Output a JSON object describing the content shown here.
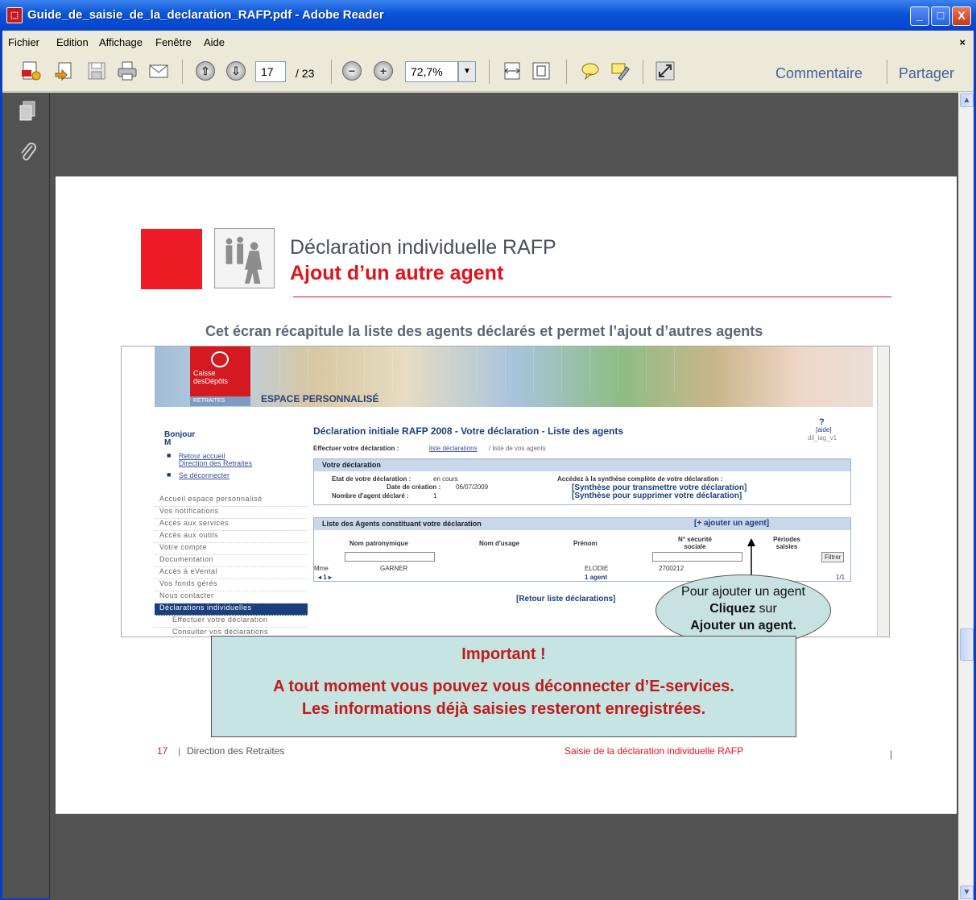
{
  "window": {
    "title": "Guide_de_saisie_de_la_declaration_RAFP.pdf - Adobe Reader",
    "buttons": {
      "minimize": "_",
      "maximize": "□",
      "close": "X"
    }
  },
  "menu": {
    "items": [
      "Fichier",
      "Edition",
      "Affichage",
      "Fenêtre",
      "Aide"
    ],
    "close_doc": "×"
  },
  "toolbar": {
    "page_current": "17",
    "page_total": "/ 23",
    "zoom": "72,7%",
    "commentaire": "Commentaire",
    "partager": "Partager"
  },
  "page": {
    "heading1": "Déclaration individuelle RAFP",
    "heading2": "Ajout d’un autre agent",
    "caption": "Cet écran récapitule la liste des agents déclarés et permet l’ajout d’autres agents",
    "screenshot": {
      "logo_line1": "Caisse",
      "logo_line2": "desDépôts",
      "logo_sub": "RETRAITES",
      "espace": "ESPACE PERSONNALISÉ",
      "bonjour": "Bonjour",
      "user_initial": "M",
      "links": [
        "Retour accueil",
        "Direction des Retraites",
        "Se déconnecter"
      ],
      "nav": [
        "Accueil espace personnalisé",
        "Vos notifications",
        "Accès aux services",
        "Accès aux outils",
        "Votre compte",
        "Documentation",
        "Accès à eVental",
        "Vos fonds gérés",
        "Nous contacter",
        "Déclarations individuelles",
        "Effectuer votre déclaration",
        "Consulter vos déclarations"
      ],
      "main_title": "Déclaration initiale RAFP 2008 - Votre déclaration - Liste des agents",
      "aide": "[aide]",
      "code": "dil_iag_v1",
      "breadcrumb_label": "Effectuer votre déclaration :",
      "breadcrumb_link": "liste déclarations",
      "breadcrumb_rest": "/ liste de vos agents",
      "box1_title": "Votre déclaration",
      "etat_label": "Etat de votre déclaration :",
      "etat_value": "en cours",
      "date_label": "Date de création :",
      "date_value": "06/07/2009",
      "nb_label": "Nombre d'agent déclaré :",
      "nb_value": "1",
      "synth_intro": "Accédez à la synthèse complète de votre déclaration :",
      "synth_transmettre": "[Synthèse pour transmettre votre déclaration]",
      "synth_supprimer": "[Synthèse pour supprimer votre déclaration]",
      "box2_title": "Liste des Agents constituant votre déclaration",
      "add_agent": "[+ ajouter un agent]",
      "columns": [
        "Nom patronymique",
        "Nom d'usage",
        "Prénom",
        "N° sécurité sociale",
        "Périodes saisies"
      ],
      "filter": "Filtrer",
      "row": {
        "civ": "Mme",
        "nom": "GARNER",
        "prenom": "ELODIE",
        "nss": "2700212"
      },
      "count": "1 agent",
      "pager": "1/1",
      "retour": "[Retour liste déclarations]"
    },
    "callout_line1": "Pour ajouter un agent",
    "callout_bold": "Cliquez",
    "callout_sur": "sur",
    "callout_line3": "Ajouter un agent.",
    "important_title": "Important !",
    "important_line1": "A tout moment vous pouvez vous déconnecter d’E-services.",
    "important_line2": "Les informations déjà saisies resteront enregistrées.",
    "footer_page": "17",
    "footer_left": "Direction des Retraites",
    "footer_right": "Saisie de la déclaration individuelle RAFP"
  }
}
